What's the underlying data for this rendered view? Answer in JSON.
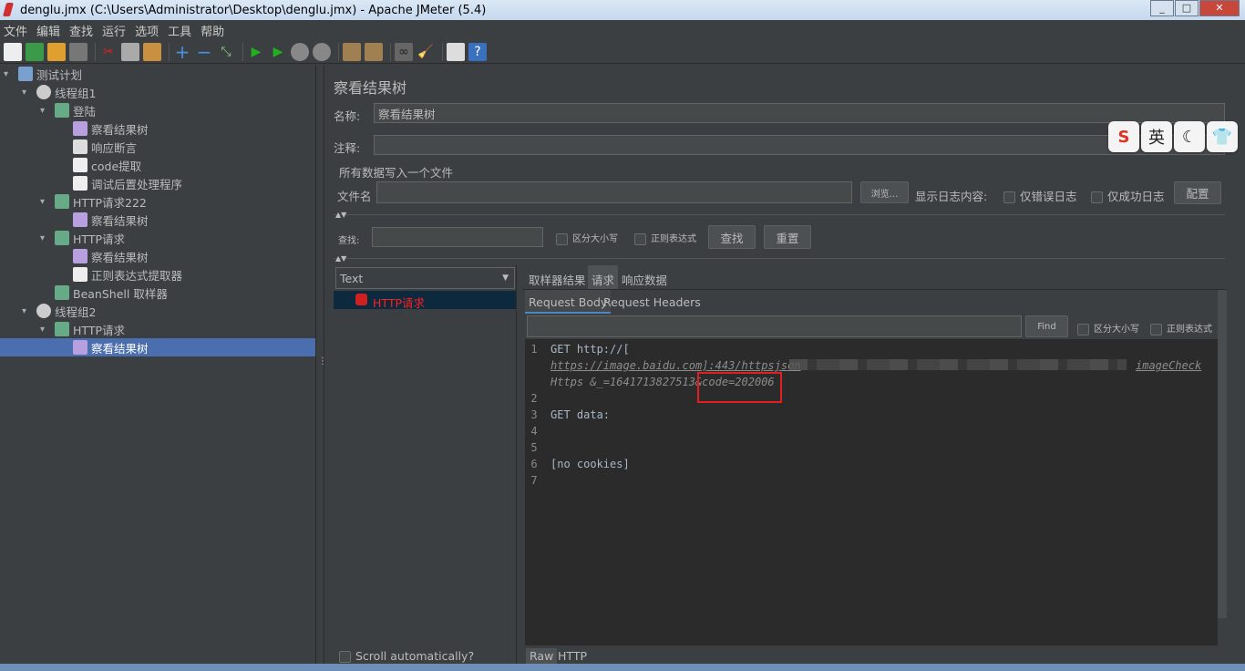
{
  "window": {
    "title": "denglu.jmx (C:\\Users\\Administrator\\Desktop\\denglu.jmx) - Apache JMeter (5.4)",
    "controls": [
      "minimize",
      "maximize",
      "close"
    ]
  },
  "menu": [
    "文件",
    "编辑",
    "查找",
    "运行",
    "选项",
    "工具",
    "帮助"
  ],
  "toolbar": [
    "new-icon",
    "templates-icon",
    "open-icon",
    "save-icon",
    "cut-icon",
    "copy-icon",
    "paste-icon",
    "expand-icon",
    "collapse-icon",
    "toggle-icon",
    "start-icon",
    "start-no-pause-icon",
    "stop-icon",
    "shutdown-icon",
    "clear-icon",
    "clear-all-icon",
    "search-icon",
    "reset-search-icon",
    "function-helper-icon",
    "help-icon"
  ],
  "tree": [
    {
      "label": "测试计划",
      "level": 0
    },
    {
      "label": "线程组1",
      "level": 1
    },
    {
      "label": "登陆",
      "level": 2
    },
    {
      "label": "察看结果树",
      "level": 3
    },
    {
      "label": "响应断言",
      "level": 3
    },
    {
      "label": "code提取",
      "level": 3
    },
    {
      "label": "调试后置处理程序",
      "level": 3
    },
    {
      "label": "HTTP请求222",
      "level": 2
    },
    {
      "label": "察看结果树",
      "level": 3
    },
    {
      "label": "HTTP请求",
      "level": 2
    },
    {
      "label": "察看结果树",
      "level": 3
    },
    {
      "label": "正则表达式提取器",
      "level": 3
    },
    {
      "label": "BeanShell 取样器",
      "level": 2
    },
    {
      "label": "线程组2",
      "level": 1
    },
    {
      "label": "HTTP请求",
      "level": 2
    },
    {
      "label": "察看结果树",
      "level": 3,
      "selected": true
    }
  ],
  "panel": {
    "title": "察看结果树",
    "name_label": "名称:",
    "name_value": "察看结果树",
    "comment_label": "注释:",
    "comment_value": "",
    "file_section": "所有数据写入一个文件",
    "filename_label": "文件名",
    "filename_value": "",
    "browse": "浏览...",
    "log_label": "显示日志内容:",
    "errors_only": "仅错误日志",
    "success_only": "仅成功日志",
    "configure": "配置",
    "search_label": "查找:",
    "search_value": "",
    "case_sensitive": "区分大小写",
    "regex": "正则表达式",
    "search_btn": "查找",
    "reset_btn": "重置",
    "renderer": "Text",
    "results": [
      {
        "label": "HTTP请求",
        "status": "error",
        "color": "#ff2020"
      }
    ],
    "scroll_auto": "Scroll automatically?",
    "tabs": [
      "取样器结果",
      "请求",
      "响应数据"
    ],
    "active_tab": "请求",
    "subtabs": [
      "Request Body",
      "Request Headers"
    ],
    "active_subtab": "Request Body",
    "find_btn": "Find",
    "find_case": "区分大小写",
    "find_regex": "正则表达式",
    "code_lines": [
      {
        "n": "1",
        "text": "GET http://["
      },
      {
        "n": "",
        "text": "https://image.baidu.com]:443/httpsjson",
        "tail": "imageCheck"
      },
      {
        "n": "",
        "text": "Https &_=1641713827513&code=202006"
      },
      {
        "n": "2",
        "text": ""
      },
      {
        "n": "3",
        "text": "GET data:"
      },
      {
        "n": "4",
        "text": ""
      },
      {
        "n": "5",
        "text": ""
      },
      {
        "n": "6",
        "text": "[no cookies]"
      },
      {
        "n": "7",
        "text": ""
      }
    ],
    "bottom_tabs": [
      "Raw",
      "HTTP"
    ],
    "active_bottom_tab": "Raw"
  },
  "ime": [
    "S",
    "英",
    "☾",
    "👕"
  ],
  "colors": {
    "bg": "#3c3f41",
    "selection": "#4b6eaf",
    "highlight": "#e02020"
  }
}
